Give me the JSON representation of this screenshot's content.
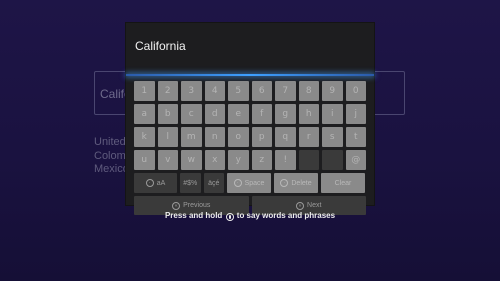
{
  "background": {
    "search_text": "Californ",
    "suggestions": [
      "United S",
      "Colomb",
      "Mexico"
    ]
  },
  "keyboard": {
    "input_value": "California",
    "rows": [
      [
        "1",
        "2",
        "3",
        "4",
        "5",
        "6",
        "7",
        "8",
        "9",
        "0"
      ],
      [
        "a",
        "b",
        "c",
        "d",
        "e",
        "f",
        "g",
        "h",
        "i",
        "j"
      ],
      [
        "k",
        "l",
        "m",
        "n",
        "o",
        "p",
        "q",
        "r",
        "s",
        "t"
      ],
      [
        "u",
        "v",
        "w",
        "x",
        "y",
        "z",
        "!",
        "",
        "",
        "@"
      ]
    ],
    "function_keys": {
      "case_label": "aA",
      "symbols_label": "#$%",
      "accents_label": "äçé",
      "space_label": "Space",
      "delete_label": "Delete",
      "clear_label": "Clear"
    },
    "nav": {
      "previous_label": "Previous",
      "next_label": "Next"
    }
  },
  "hint": {
    "before": "Press and hold",
    "after": "to say words and phrases"
  },
  "colors": {
    "accent": "#3ea0ff",
    "background": "#1a1240"
  }
}
